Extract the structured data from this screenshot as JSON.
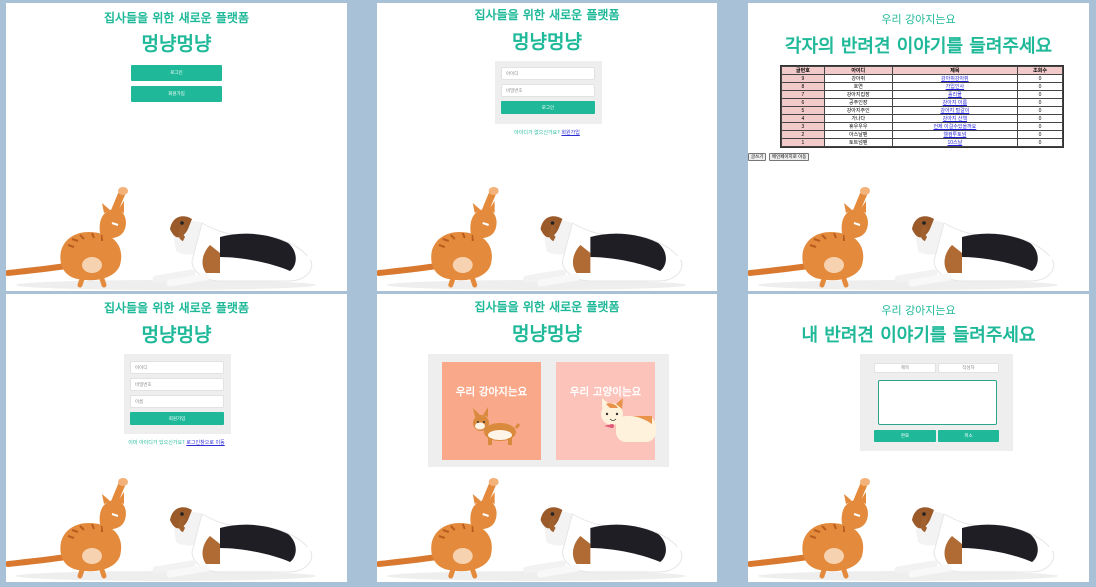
{
  "site": {
    "subtitle": "집사들을 위한 새로운 플랫폼",
    "brand": "멍냥멍냥"
  },
  "home": {
    "login_button": "로그인",
    "signup_button": "회원가입"
  },
  "login": {
    "id_placeholder": "아이디",
    "pw_placeholder": "비밀번호",
    "login_button": "로그인",
    "note_prefix": "아이디가 없으신가요?",
    "note_link": "회원가입"
  },
  "board": {
    "heading_small": "우리 강아지는요",
    "heading_large": "각자의 반려견 이야기를 들려주세요",
    "columns": [
      "글번호",
      "아이디",
      "제목",
      "조회수"
    ],
    "rows": [
      {
        "no": "9",
        "id": "강아쥐",
        "title": "강아쥐강아쥐",
        "views": "0"
      },
      {
        "no": "8",
        "id": "호연",
        "title": "가입인사",
        "views": "0"
      },
      {
        "no": "7",
        "id": "강아지집장",
        "title": "홀리몰",
        "views": "0"
      },
      {
        "no": "6",
        "id": "공주인장",
        "title": "강아지 이름",
        "views": "0"
      },
      {
        "no": "5",
        "id": "강아지주인",
        "title": "강아지 털갈이",
        "views": "0"
      },
      {
        "no": "4",
        "id": "가나다",
        "title": "강아지 산책",
        "views": "0"
      },
      {
        "no": "3",
        "id": "휴우우우",
        "title": "언제 이걸수있을까요",
        "views": "0"
      },
      {
        "no": "2",
        "id": "아스날팬",
        "title": "웰컴투토넘",
        "views": "0"
      },
      {
        "no": "1",
        "id": "토트넘팬",
        "title": "10스날",
        "views": "0"
      }
    ],
    "write_button": "글쓰기",
    "main_button": "메인페이지로 이동"
  },
  "signup": {
    "id_placeholder": "아이디",
    "pw_placeholder": "비밀번호",
    "name_placeholder": "이름",
    "signup_button": "회원가입",
    "note_prefix": "이미 아이디가 있으신가요?",
    "note_link": "로그인창으로 이동"
  },
  "select": {
    "dog_card": "우리 강아지는요",
    "cat_card": "우리 고양이는요",
    "dog_color": "#f9a98a",
    "cat_color": "#fcc3ba"
  },
  "write": {
    "heading_small": "우리 강아지는요",
    "heading_large": "내 반려견 이야기를 들려주세요",
    "title_placeholder": "제목",
    "author_placeholder": "작성자",
    "complete_button": "완료",
    "cancel_button": "취소"
  },
  "colors": {
    "accent": "#1fb999",
    "background": "#a9c1d6",
    "table_header": "#f3caca"
  }
}
